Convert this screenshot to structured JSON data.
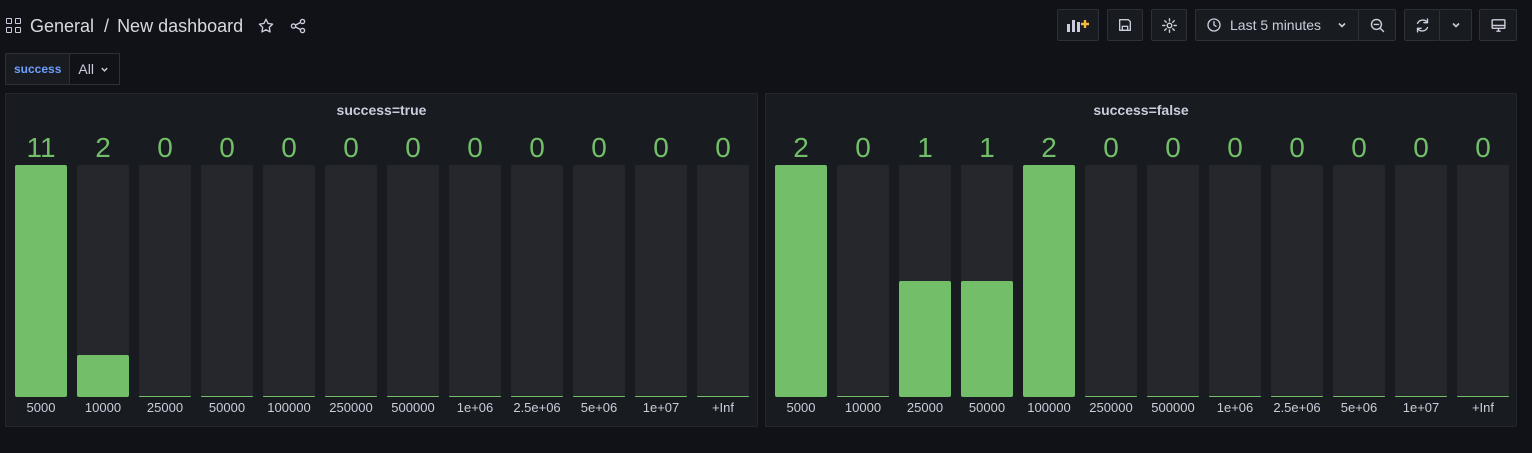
{
  "header": {
    "folder": "General",
    "separator": "/",
    "dashboard": "New dashboard",
    "time_range": "Last 5 minutes"
  },
  "variables": [
    {
      "label": "success",
      "value": "All"
    }
  ],
  "colors": {
    "bar": "#73bf69",
    "track": "#25272c",
    "accent": "#6e9fff"
  },
  "panels": [
    {
      "title": "success=true",
      "bars": [
        {
          "le": "5000",
          "value": 11
        },
        {
          "le": "10000",
          "value": 2
        },
        {
          "le": "25000",
          "value": 0
        },
        {
          "le": "50000",
          "value": 0
        },
        {
          "le": "100000",
          "value": 0
        },
        {
          "le": "250000",
          "value": 0
        },
        {
          "le": "500000",
          "value": 0
        },
        {
          "le": "1e+06",
          "value": 0
        },
        {
          "le": "2.5e+06",
          "value": 0
        },
        {
          "le": "5e+06",
          "value": 0
        },
        {
          "le": "1e+07",
          "value": 0
        },
        {
          "le": "+Inf",
          "value": 0
        }
      ]
    },
    {
      "title": "success=false",
      "bars": [
        {
          "le": "5000",
          "value": 2
        },
        {
          "le": "10000",
          "value": 0
        },
        {
          "le": "25000",
          "value": 1
        },
        {
          "le": "50000",
          "value": 1
        },
        {
          "le": "100000",
          "value": 2
        },
        {
          "le": "250000",
          "value": 0
        },
        {
          "le": "500000",
          "value": 0
        },
        {
          "le": "1e+06",
          "value": 0
        },
        {
          "le": "2.5e+06",
          "value": 0
        },
        {
          "le": "5e+06",
          "value": 0
        },
        {
          "le": "1e+07",
          "value": 0
        },
        {
          "le": "+Inf",
          "value": 0
        }
      ]
    }
  ]
}
